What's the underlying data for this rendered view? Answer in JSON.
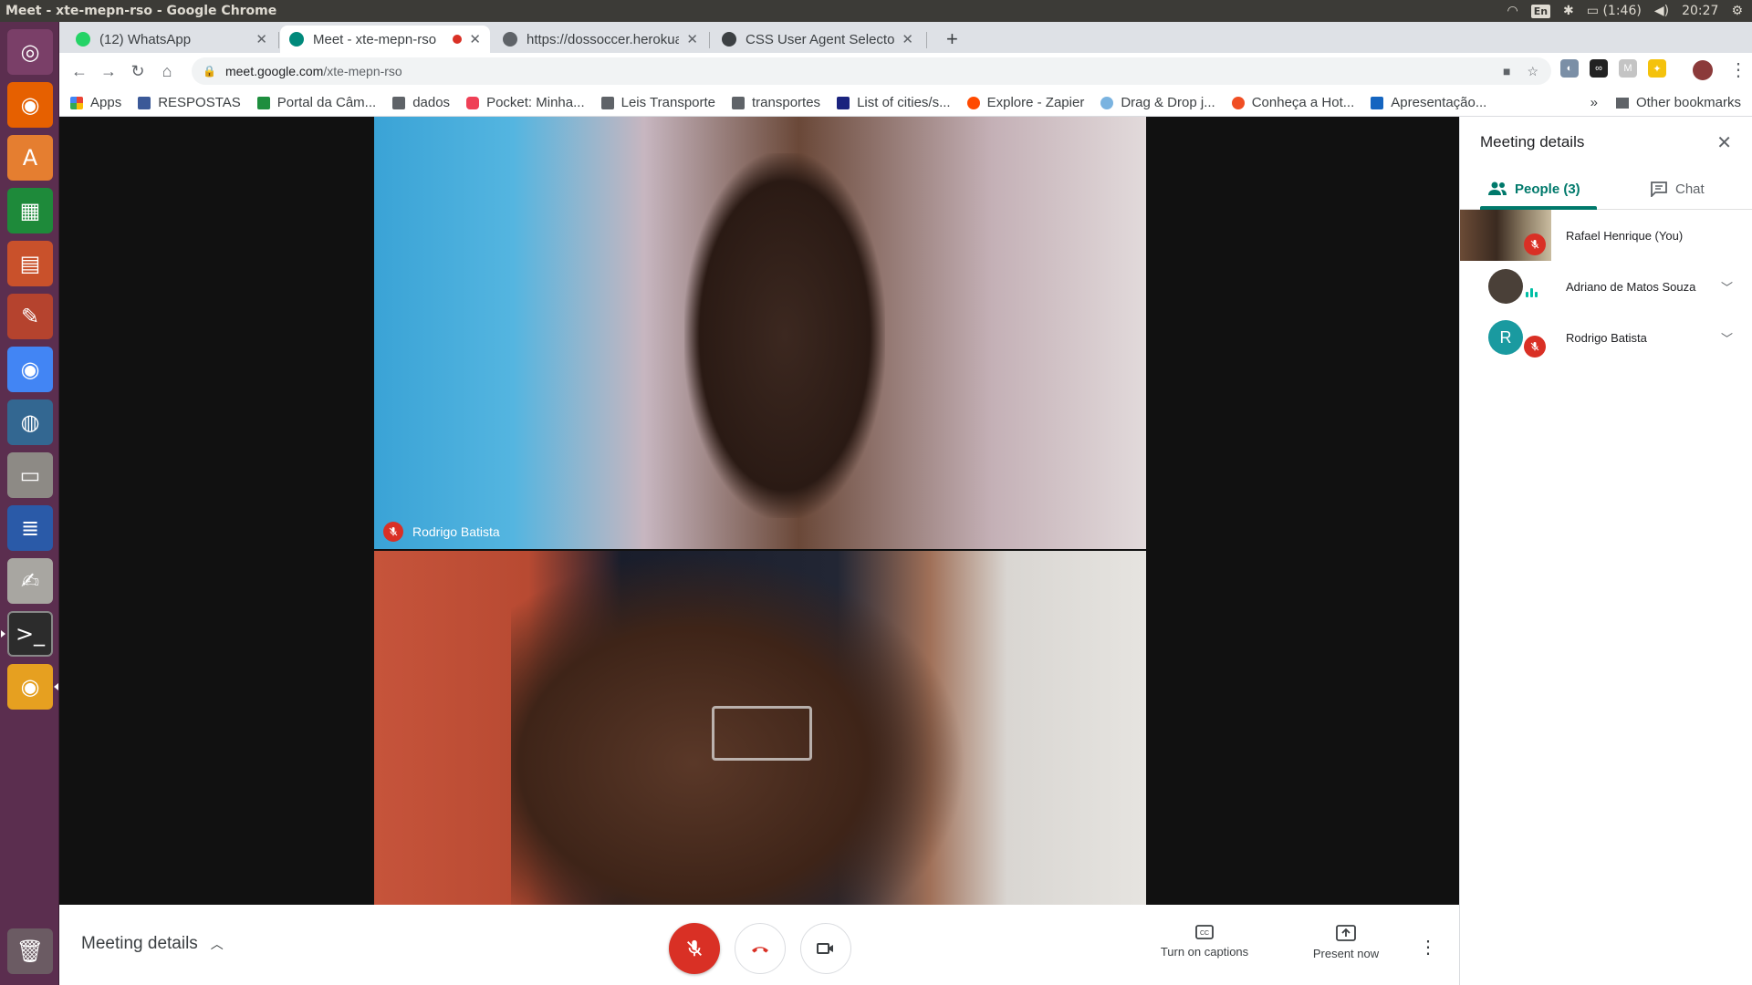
{
  "os": {
    "window_title": "Meet - xte-mepn-rso - Google Chrome",
    "lang": "En",
    "battery": "(1:46)",
    "clock": "20:27"
  },
  "browser": {
    "tabs": [
      {
        "label": "(12) WhatsApp",
        "badge": "12"
      },
      {
        "label": "Meet - xte-mepn-rso"
      },
      {
        "label": "https://dossoccer.herokuapp.com"
      },
      {
        "label": "CSS User Agent Selectors"
      }
    ],
    "url_host": "meet.google.com",
    "url_path": "/xte-mepn-rso",
    "bookmarks": [
      {
        "label": "Apps"
      },
      {
        "label": "RESPOSTAS"
      },
      {
        "label": "Portal da Câm..."
      },
      {
        "label": "dados"
      },
      {
        "label": "Pocket: Minha..."
      },
      {
        "label": "Leis Transporte"
      },
      {
        "label": "transportes"
      },
      {
        "label": "List of cities/s..."
      },
      {
        "label": "Explore - Zapier"
      },
      {
        "label": "Drag & Drop j..."
      },
      {
        "label": "Conheça a Hot..."
      },
      {
        "label": "Apresentação..."
      }
    ],
    "bookmarks_overflow": "»",
    "other_bookmarks": "Other bookmarks"
  },
  "meet": {
    "tile1_name": "Rodrigo Batista",
    "meeting_details_label": "Meeting details",
    "captions_label": "Turn on captions",
    "present_label": "Present now",
    "panel": {
      "title": "Meeting details",
      "people_tab": "People (3)",
      "chat_tab": "Chat",
      "participants": [
        {
          "name": "Rafael Henrique (You)",
          "muted": true
        },
        {
          "name": "Adriano de Matos Souza",
          "speaking": true
        },
        {
          "name": "Rodrigo Batista",
          "muted": true,
          "initial": "R"
        }
      ]
    }
  },
  "colors": {
    "meet_red": "#d93025",
    "meet_teal": "#00796b",
    "avatar_teal": "#1a9aa0",
    "launcher": "#5b2e4f"
  }
}
